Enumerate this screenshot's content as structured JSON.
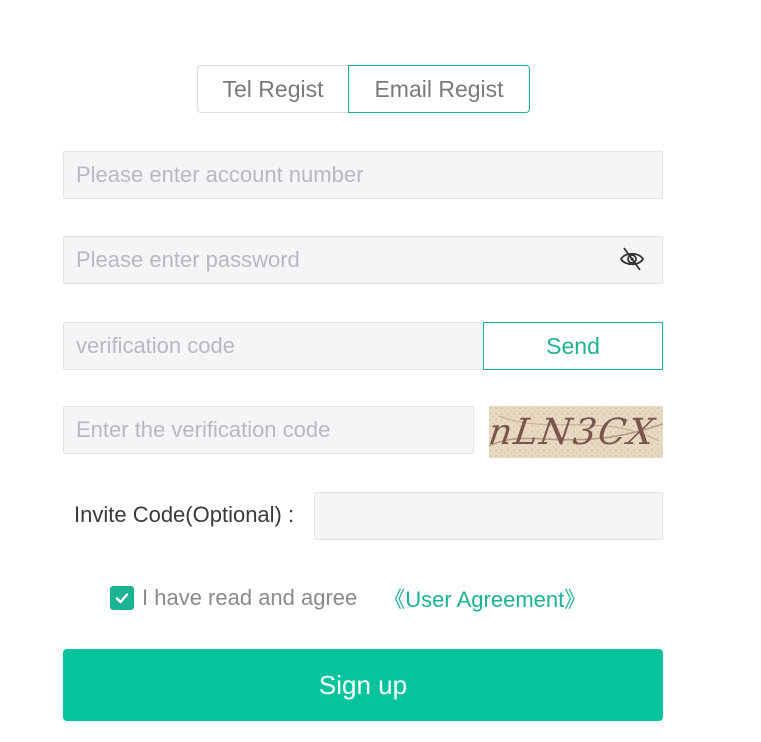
{
  "tabs": [
    {
      "label": "Tel Regist",
      "active": false
    },
    {
      "label": "Email Regist",
      "active": true
    }
  ],
  "form": {
    "account_placeholder": "Please enter account number",
    "password_placeholder": "Please enter password",
    "password_toggle_icon": "eye-slash-icon",
    "verification_placeholder": "verification code",
    "send_label": "Send",
    "captcha_placeholder": "Enter the verification code",
    "captcha_text": "nLN3CX",
    "invite_label": "Invite Code(Optional) :",
    "invite_value": ""
  },
  "agreement": {
    "checked": true,
    "text": "I have read and agree",
    "link_label": "《User Agreement》"
  },
  "submit_label": "Sign up",
  "colors": {
    "accent": "#1cb394",
    "button": "#05c49d",
    "field_bg": "#f5f5f8"
  }
}
